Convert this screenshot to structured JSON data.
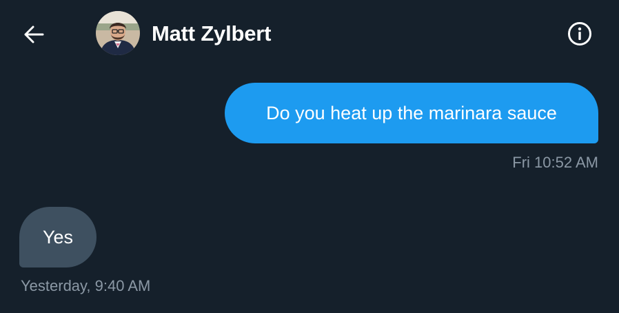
{
  "header": {
    "contact_name": "Matt Zylbert",
    "back_icon": "arrow-left-icon",
    "info_icon": "info-circle-icon"
  },
  "messages": [
    {
      "direction": "outgoing",
      "text": "Do you heat up the marinara sauce",
      "timestamp": "Fri 10:52 AM"
    },
    {
      "direction": "incoming",
      "text": "Yes",
      "timestamp": "Yesterday, 9:40 AM"
    }
  ],
  "colors": {
    "background": "#15202b",
    "outgoing_bubble": "#1d9bf0",
    "incoming_bubble": "#3e5060",
    "timestamp": "#8b98a5",
    "text": "#ffffff"
  }
}
